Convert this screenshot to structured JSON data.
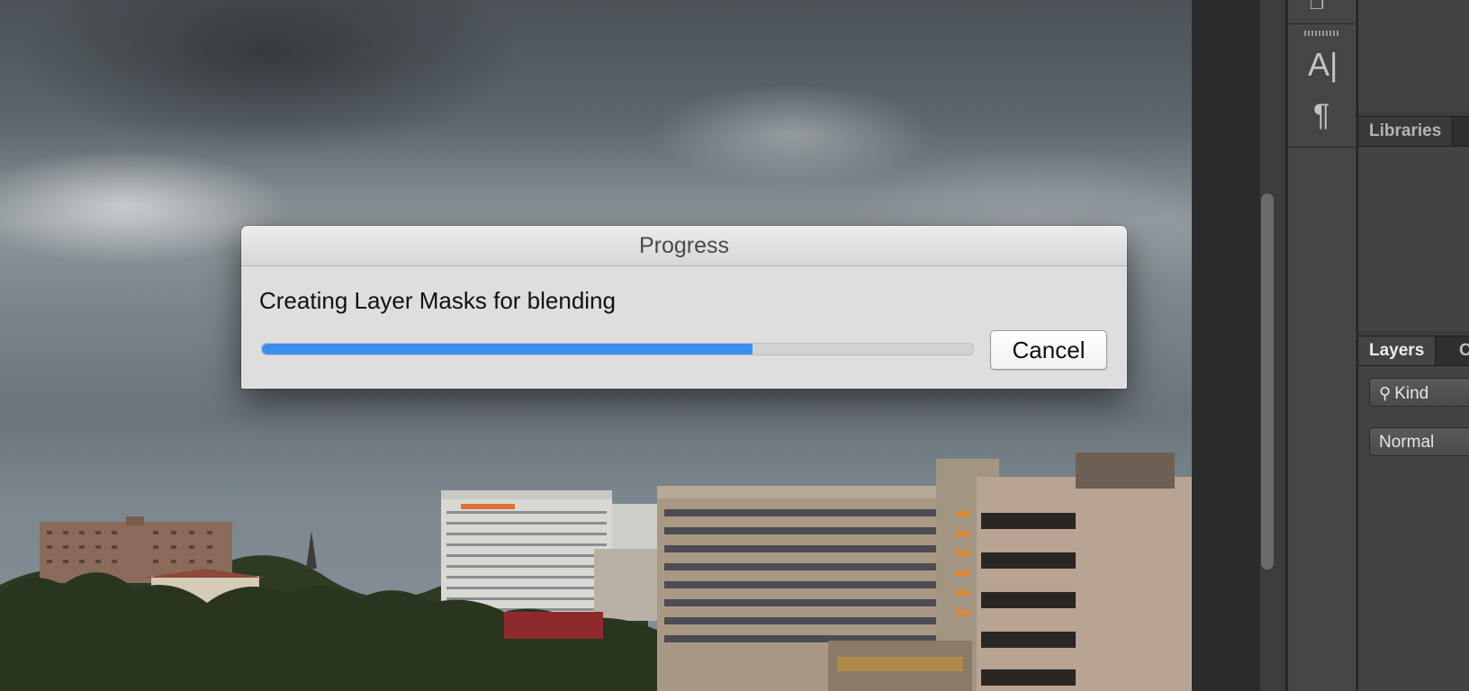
{
  "dialog": {
    "title": "Progress",
    "message": "Creating Layer Masks for blending",
    "progress": 0.69,
    "cancel_label": "Cancel"
  },
  "toolbar": {
    "icons": [
      "arrange-icon",
      "character-icon",
      "paragraph-icon"
    ],
    "character_glyph": "A|",
    "paragraph_glyph": "¶"
  },
  "panels": {
    "libraries_tab": "Libraries",
    "layers_tab": "Layers",
    "next_tab_partial": "C",
    "filter_kind": "Kind",
    "blend_mode": "Normal"
  },
  "colors": {
    "progress_fill": "#3b8fef",
    "panel_bg": "#434343"
  }
}
